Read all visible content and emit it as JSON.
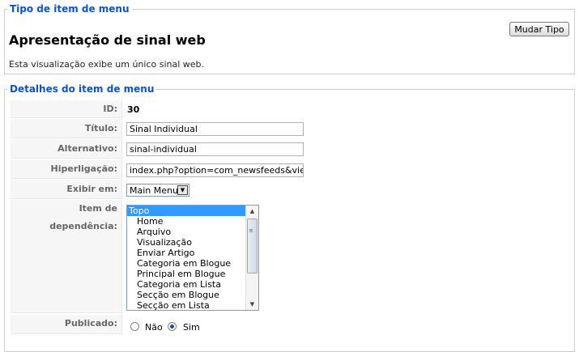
{
  "type_section": {
    "legend": "Tipo de item de menu",
    "title": "Apresentação de sinal web",
    "description": "Esta visualização exibe um único sinal web.",
    "change_button": "Mudar Tipo"
  },
  "details_section": {
    "legend": "Detalhes do item de menu",
    "id_label": "ID:",
    "id_value": "30",
    "title_label": "Título:",
    "title_value": "Sinal Individual",
    "alias_label": "Alternativo:",
    "alias_value": "sinal-individual",
    "link_label": "Hiperligação:",
    "link_value": "index.php?option=com_newsfeeds&view=new",
    "menu_label": "Exibir em:",
    "menu_value": "Main Menu",
    "parent_label": "Item de dependência:",
    "parent_options": [
      "Topo",
      "Home",
      "Arquivo",
      "Visualização",
      "Enviar Artigo",
      "Categoria em Blogue",
      "Principal em Blogue",
      "Categoria em Lista",
      "Secção em Blogue",
      "Secção em Lista"
    ],
    "parent_selected_index": 0,
    "published_label": "Publicado:",
    "published_no": "Não",
    "published_yes": "Sim",
    "published_value": "Sim"
  }
}
